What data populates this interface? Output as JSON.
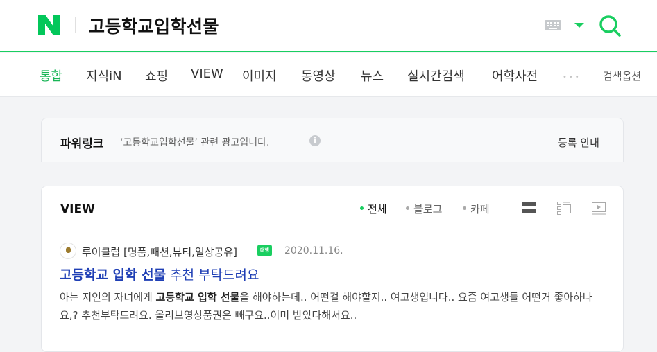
{
  "header": {
    "query": "고등학교입학선물",
    "brand_color": "#19ce60"
  },
  "tabs": [
    {
      "label": "통합",
      "active": true
    },
    {
      "label": "지식iN"
    },
    {
      "label": "쇼핑"
    },
    {
      "label": "VIEW"
    },
    {
      "label": "이미지"
    },
    {
      "label": "동영상"
    },
    {
      "label": "뉴스"
    },
    {
      "label": "실시간검색"
    },
    {
      "label": "어학사전"
    }
  ],
  "tabbar": {
    "more": "•••",
    "search_options": "검색옵션"
  },
  "powerlink": {
    "title": "파워링크",
    "desc": "‘고등학교입학선물’ 관련 광고입니다.",
    "info": "i",
    "register": "등록 안내"
  },
  "view": {
    "title": "VIEW",
    "filters": [
      "전체",
      "블로그",
      "카페"
    ],
    "post": {
      "author": "루이클럽 [명품,패션,뷰티,일상공유]",
      "badge": "대행",
      "date": "2020.11.16.",
      "title_bold": "고등학교 입학 선물",
      "title_rest": " 추천 부탁드려요",
      "snippet_a": "아는 지인의 자녀에게 ",
      "snippet_b": "고등학교 입학 선물",
      "snippet_c": "을 해야하는데.. 어떤걸 해야할지.. 여고생입니다.. 요즘 여고생들 어떤거 좋아하나요,? 추천부탁드려요. 올리브영상품권은 빼구요..이미 받았다해서요.."
    }
  }
}
